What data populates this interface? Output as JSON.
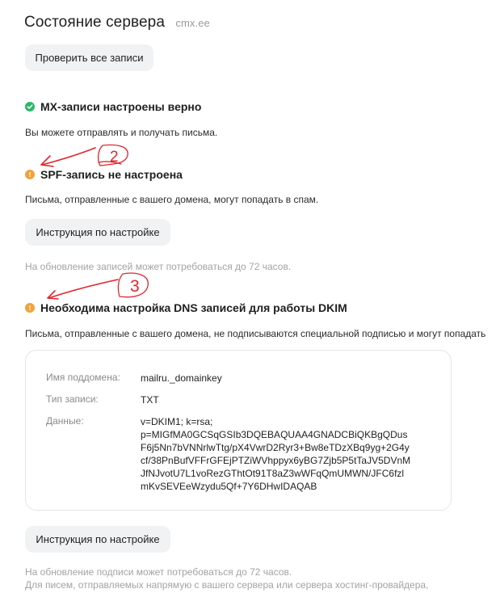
{
  "header": {
    "title": "Состояние сервера",
    "domain": "cmx.ee"
  },
  "check_all_button": "Проверить все записи",
  "mx": {
    "title": "MX-записи настроены верно",
    "description": "Вы можете отправлять и получать письма."
  },
  "spf": {
    "title": "SPF-запись не настроена",
    "description": "Письма, отправленные с вашего домена, могут попадать в спам.",
    "button": "Инструкция по настройке",
    "note": "На обновление записей может потребоваться до 72 часов."
  },
  "dkim": {
    "title": "Необходима настройка DNS записей для работы DKIM",
    "description": "Письма, отправленные с вашего домена, не подписываются специальной подписью и могут попадать",
    "card": {
      "subdomain_label": "Имя поддомена:",
      "subdomain_value": "mailru._domainkey",
      "type_label": "Тип записи:",
      "type_value": "TXT",
      "data_label": "Данные:",
      "data_value": "v=DKIM1; k=rsa;\np=MIGfMA0GCSqGSIb3DQEBAQUAA4GNADCBiQKBgQDus\nF6j5Nn7bVNNrlwTtg/pX4VwrD2Ryr3+Bw8eTDzXBq9yg+2G4y\ncf/38PnBufVFFrGFEjPTZiWVhppyx6yBG7Zjb5P5tTaJV5DVnM\nJfNJvotU7L1voRezGThtOt91T8aZ3wWFqQmUMWN/JFC6fzl\nmKvSEVEeWzydu5Qf+7Y6DHwIDAQAB"
    },
    "button": "Инструкция по настройке",
    "note_1": "На обновление подписи может потребоваться до 72 часов.",
    "note_2": "Для писем, отправляемых напрямую с вашего сервера или сервера хостинг-провайдера,"
  },
  "annotations": {
    "mark_2": "2",
    "mark_3": "3"
  },
  "colors": {
    "ok": "#2fb66b",
    "warning": "#f2a23a",
    "annotation": "#e0262b",
    "button_bg": "#f1f2f4"
  },
  "icons": {
    "ok": "check-circle-icon",
    "warning": "exclamation-circle-icon"
  }
}
